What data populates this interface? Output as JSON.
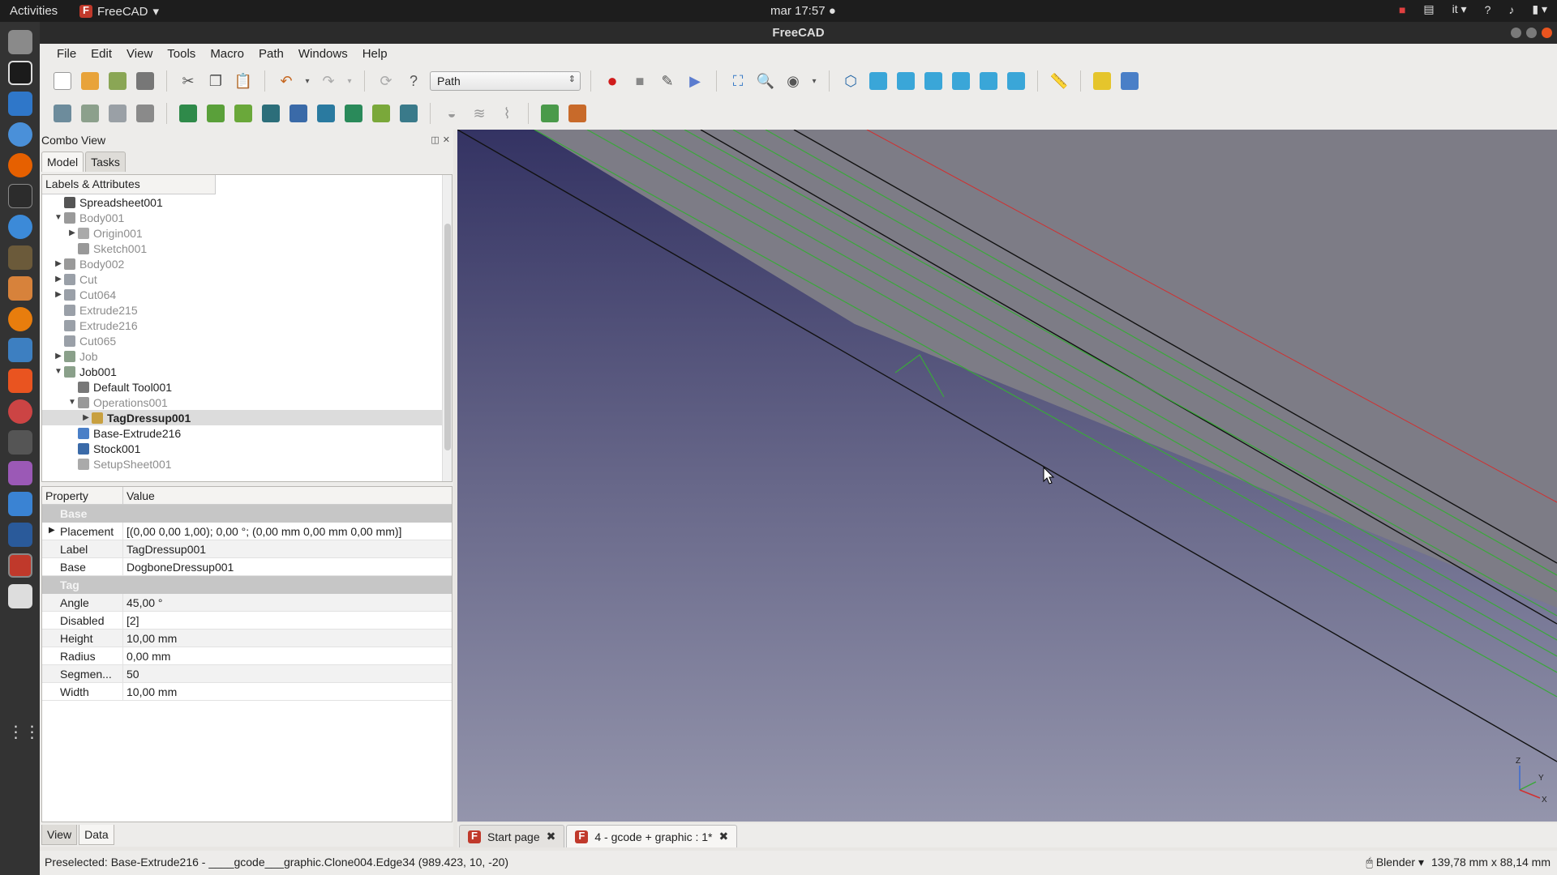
{
  "topbar": {
    "activities": "Activities",
    "app_name": "FreeCAD",
    "clock": "mar 17:57",
    "lang": "it"
  },
  "window": {
    "title": "FreeCAD"
  },
  "menubar": [
    "File",
    "Edit",
    "View",
    "Tools",
    "Macro",
    "Path",
    "Windows",
    "Help"
  ],
  "toolbar": {
    "workbench": "Path"
  },
  "combo": {
    "title": "Combo View",
    "tabs": [
      "Model",
      "Tasks"
    ],
    "tree_header": "Labels & Attributes",
    "tree": [
      {
        "label": "Spreadsheet001",
        "indent": 1,
        "expander": "",
        "dim": false,
        "icon": "spreadsheet-icon"
      },
      {
        "label": "Body001",
        "indent": 1,
        "expander": "▼",
        "dim": true,
        "icon": "body-icon"
      },
      {
        "label": "Origin001",
        "indent": 2,
        "expander": "▶",
        "dim": true,
        "icon": "origin-icon"
      },
      {
        "label": "Sketch001",
        "indent": 2,
        "expander": "",
        "dim": true,
        "icon": "sketch-icon"
      },
      {
        "label": "Body002",
        "indent": 1,
        "expander": "▶",
        "dim": true,
        "icon": "body-icon"
      },
      {
        "label": "Cut",
        "indent": 1,
        "expander": "▶",
        "dim": true,
        "icon": "cut-icon"
      },
      {
        "label": "Cut064",
        "indent": 1,
        "expander": "▶",
        "dim": true,
        "icon": "cut-icon"
      },
      {
        "label": "Extrude215",
        "indent": 1,
        "expander": "",
        "dim": true,
        "icon": "extrude-icon"
      },
      {
        "label": "Extrude216",
        "indent": 1,
        "expander": "",
        "dim": true,
        "icon": "extrude-icon"
      },
      {
        "label": "Cut065",
        "indent": 1,
        "expander": "",
        "dim": true,
        "icon": "cut-icon"
      },
      {
        "label": "Job",
        "indent": 1,
        "expander": "▶",
        "dim": true,
        "icon": "job-icon"
      },
      {
        "label": "Job001",
        "indent": 1,
        "expander": "▼",
        "dim": false,
        "icon": "job-icon"
      },
      {
        "label": "Default Tool001",
        "indent": 2,
        "expander": "",
        "dim": false,
        "icon": "tool-icon"
      },
      {
        "label": "Operations001",
        "indent": 2,
        "expander": "▼",
        "dim": true,
        "icon": "operations-icon"
      },
      {
        "label": "TagDressup001",
        "indent": 3,
        "expander": "▶",
        "dim": false,
        "selected": true,
        "icon": "dressup-icon"
      },
      {
        "label": "Base-Extrude216",
        "indent": 2,
        "expander": "",
        "dim": false,
        "icon": "base-icon"
      },
      {
        "label": "Stock001",
        "indent": 2,
        "expander": "",
        "dim": false,
        "icon": "stock-icon"
      },
      {
        "label": "SetupSheet001",
        "indent": 2,
        "expander": "",
        "dim": true,
        "icon": "setupsheet-icon"
      }
    ],
    "prop_headers": {
      "property": "Property",
      "value": "Value"
    },
    "property_groups": [
      {
        "group": "Base",
        "rows": [
          {
            "name": "Placement",
            "value": "[(0,00 0,00 1,00); 0,00 °; (0,00 mm  0,00 mm  0,00 mm)]",
            "expander": "▶"
          },
          {
            "name": "Label",
            "value": "TagDressup001"
          },
          {
            "name": "Base",
            "value": "DogboneDressup001"
          }
        ]
      },
      {
        "group": "Tag",
        "rows": [
          {
            "name": "Angle",
            "value": "45,00 °"
          },
          {
            "name": "Disabled",
            "value": "[2]"
          },
          {
            "name": "Height",
            "value": "10,00 mm"
          },
          {
            "name": "Radius",
            "value": "0,00 mm"
          },
          {
            "name": "Segmen...",
            "value": "50"
          },
          {
            "name": "Width",
            "value": "10,00 mm"
          }
        ]
      }
    ],
    "bottom_tabs": [
      "View",
      "Data"
    ]
  },
  "viewport": {
    "axis_labels": {
      "z": "Z",
      "y": "Y",
      "x": "X"
    }
  },
  "doc_tabs": [
    {
      "label": "Start page",
      "active": false
    },
    {
      "label": "4 - gcode + graphic : 1*",
      "active": true
    }
  ],
  "status": {
    "message": "Preselected: Base-Extrude216 - ____gcode___graphic.Clone004.Edge34 (989.423, 10, -20)",
    "nav_style": "Blender",
    "dimensions": "139,78 mm x 88,14 mm"
  },
  "colors": {
    "viewport_top": "#343363",
    "viewport_bottom": "#9495ac",
    "toolpath_green": "#3aa83a",
    "edge_black": "#111111",
    "axis_red": "#d03030"
  }
}
